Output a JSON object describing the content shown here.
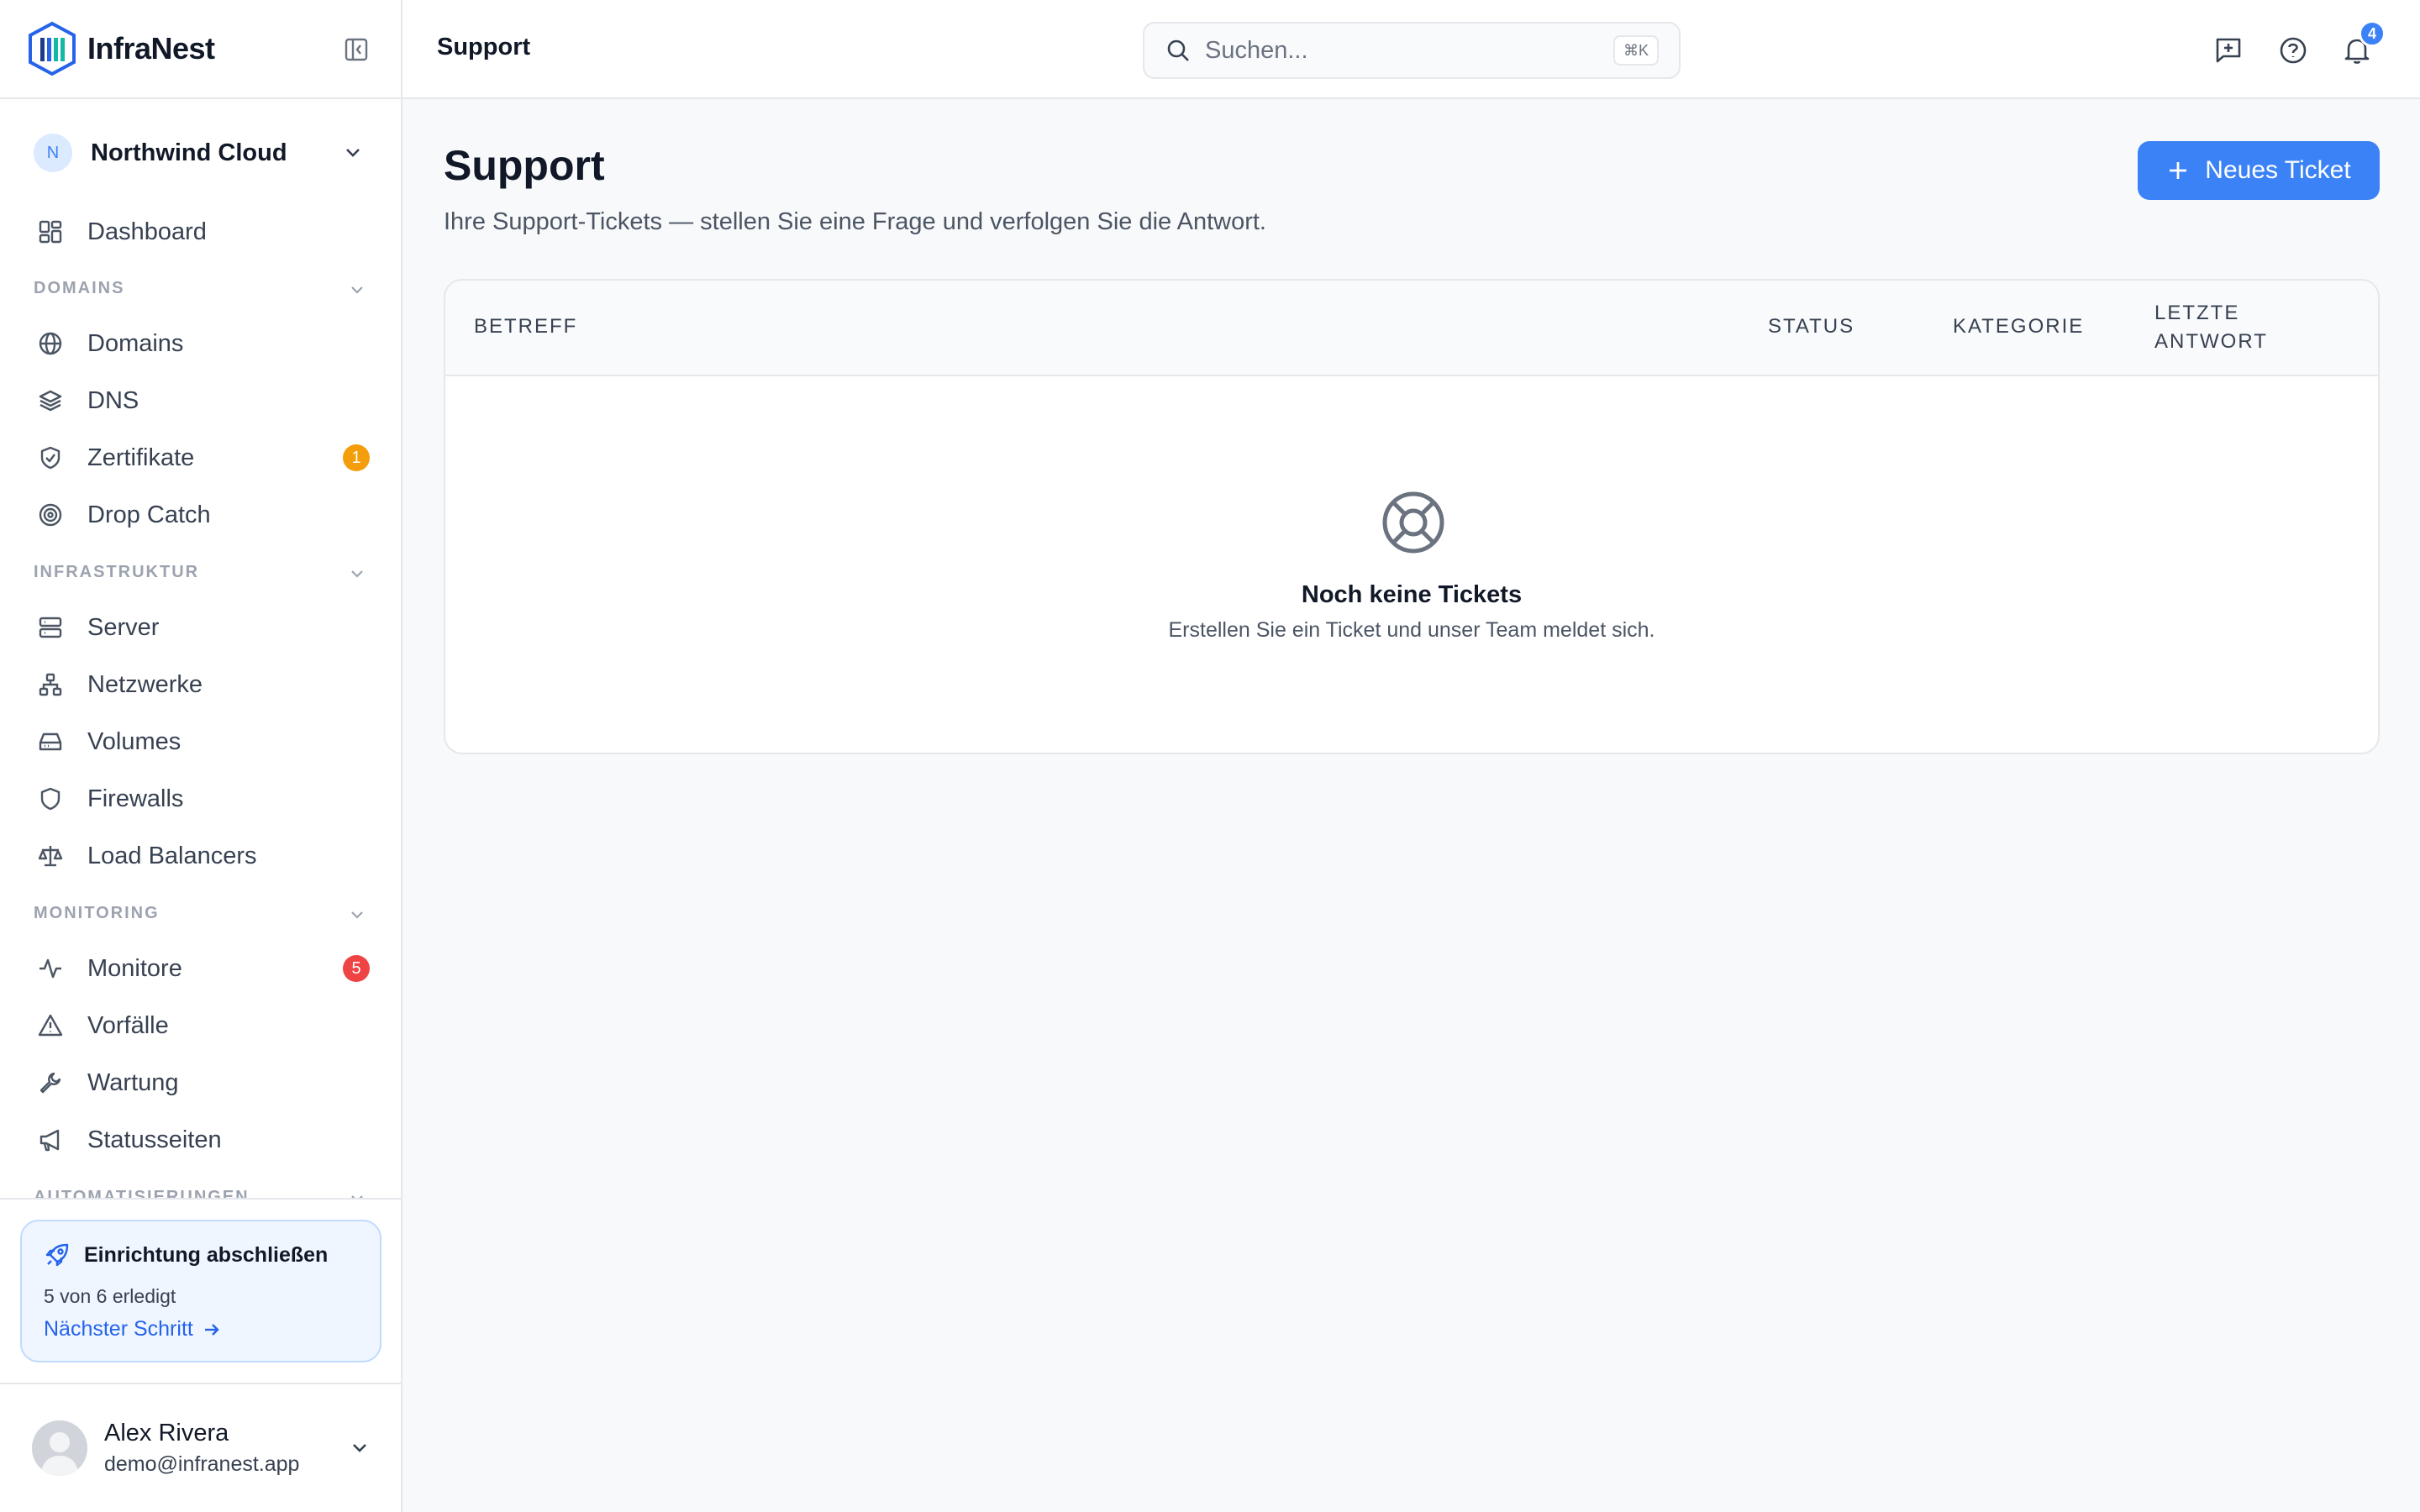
{
  "brand": {
    "name": "InfraNest"
  },
  "org": {
    "initial": "N",
    "name": "Northwind Cloud"
  },
  "nav": {
    "dashboard": "Dashboard",
    "sections": {
      "domains": "DOMAINS",
      "infra": "INFRASTRUKTUR",
      "monitoring": "MONITORING",
      "automation": "AUTOMATISIERUNGEN"
    },
    "items": {
      "domains": "Domains",
      "dns": "DNS",
      "certs": "Zertifikate",
      "certs_badge": "1",
      "dropcatch": "Drop Catch",
      "server": "Server",
      "networks": "Netzwerke",
      "volumes": "Volumes",
      "firewalls": "Firewalls",
      "lb": "Load Balancers",
      "monitors": "Monitore",
      "monitors_badge": "5",
      "incidents": "Vorfälle",
      "maintenance": "Wartung",
      "statuspages": "Statusseiten"
    }
  },
  "setup": {
    "title": "Einrichtung abschließen",
    "progress": "5 von 6 erledigt",
    "next": "Nächster Schritt"
  },
  "user": {
    "name": "Alex Rivera",
    "email": "demo@infranest.app"
  },
  "topbar": {
    "title": "Support",
    "search_placeholder": "Suchen...",
    "search_shortcut": "⌘K",
    "notifications_count": "4"
  },
  "main": {
    "title": "Support",
    "subtitle": "Ihre Support-Tickets — stellen Sie eine Frage und verfolgen Sie die Antwort.",
    "new_ticket": "Neues Ticket",
    "table": {
      "columns": [
        "BETREFF",
        "STATUS",
        "KATEGORIE",
        "LETZTE",
        "ANTWORT"
      ],
      "empty_title": "Noch keine Tickets",
      "empty_subtitle": "Erstellen Sie ein Ticket und unser Team meldet sich."
    }
  },
  "colors": {
    "accent": "#3b82f6",
    "badge_warning": "#f59e0b",
    "badge_danger": "#ef4444",
    "brand_teal": "#14b8a6"
  }
}
